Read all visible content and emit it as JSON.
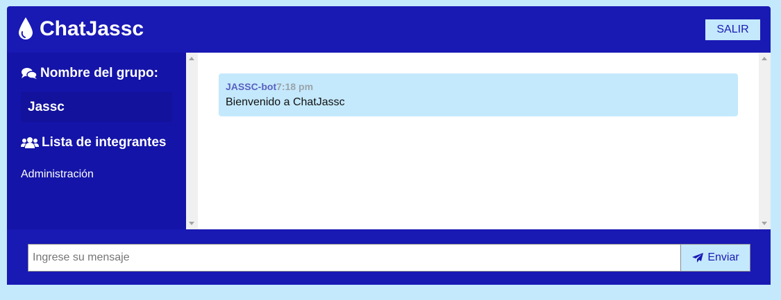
{
  "header": {
    "title": "ChatJassc",
    "logo_icon": "droplet-icon",
    "logout_label": "SALIR"
  },
  "sidebar": {
    "group_heading": "Nombre del grupo:",
    "group_heading_icon": "comments-icon",
    "group_name": "Jassc",
    "members_heading": "Lista de integrantes",
    "members_heading_icon": "users-icon",
    "members": [
      "Administración"
    ]
  },
  "messages": [
    {
      "author": "JASSC-bot",
      "time": "7:18 pm",
      "text": "Bienvenido a ChatJassc"
    }
  ],
  "composer": {
    "placeholder": "Ingrese su mensaje",
    "value": "",
    "send_label": "Enviar",
    "send_icon": "paper-plane-icon"
  },
  "colors": {
    "primary": "#1919b4",
    "sidebar": "#1414a8",
    "accent_light": "#c4e9fc",
    "message_author": "#5a60c2",
    "message_time": "#9aa3ab"
  }
}
